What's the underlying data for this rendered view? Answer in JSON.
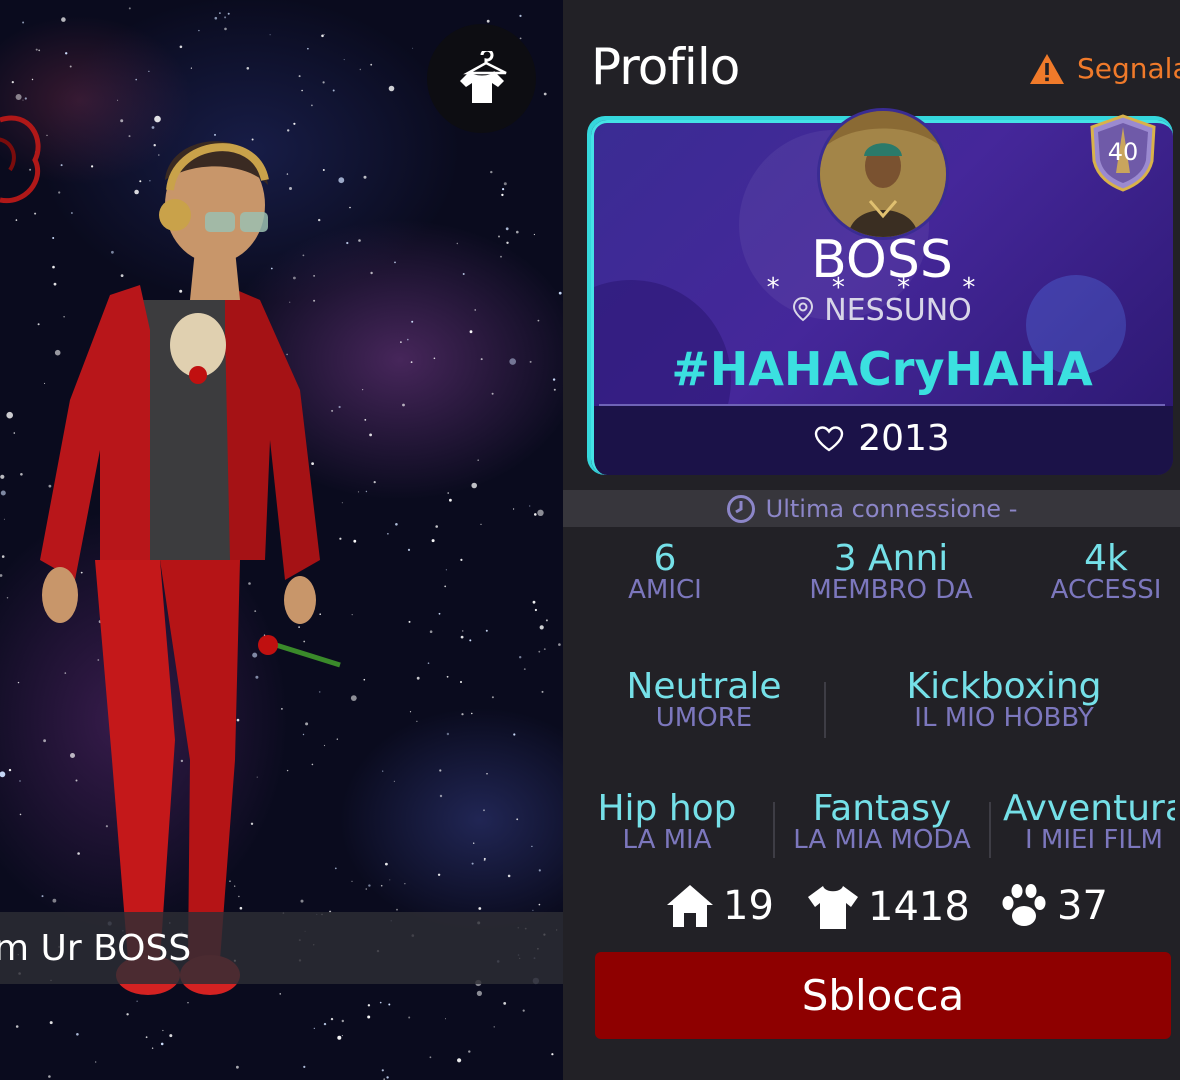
{
  "scene": {
    "caption": "m Ur BOSS",
    "outfit_button_icon": "tshirt-hanger-icon"
  },
  "profile": {
    "title": "Profilo",
    "report_label": "Segnala",
    "report_icon": "warning-icon",
    "level_badge": "40",
    "name": "BOSS",
    "star_marks": "* * * *",
    "location_icon": "location-pin-icon",
    "location": "NESSUNO",
    "hashtag": "#HAHACryHAHA",
    "likes_icon": "heart-icon",
    "likes": "2013",
    "last_connection_icon": "clock-icon",
    "last_connection": "Ultima connessione -",
    "stats": [
      {
        "value": "6",
        "label": "AMICI"
      },
      {
        "value": "3 Anni",
        "label": "MEMBRO DA"
      },
      {
        "value": "4k",
        "label": "ACCESSI"
      }
    ],
    "traits": [
      {
        "value": "Neutrale",
        "label": "UMORE"
      },
      {
        "value": "Kickboxing",
        "label": "IL MIO HOBBY"
      }
    ],
    "tastes": [
      {
        "value": "Hip hop",
        "label": "LA MIA"
      },
      {
        "value": "Fantasy",
        "label": "LA MIA MODA"
      },
      {
        "value": "Avventura",
        "label": "I MIEI FILM"
      }
    ],
    "counters": [
      {
        "icon": "home-icon",
        "value": "19"
      },
      {
        "icon": "tshirt-icon",
        "value": "1418"
      },
      {
        "icon": "paw-icon",
        "value": "37"
      }
    ],
    "unlock_label": "Sblocca"
  },
  "colors": {
    "accent_cyan": "#3be0e0",
    "label_purple": "#7c77bd",
    "report_orange": "#f07a2a",
    "unlock_red": "#8e0000",
    "panel_bg": "#222126"
  }
}
